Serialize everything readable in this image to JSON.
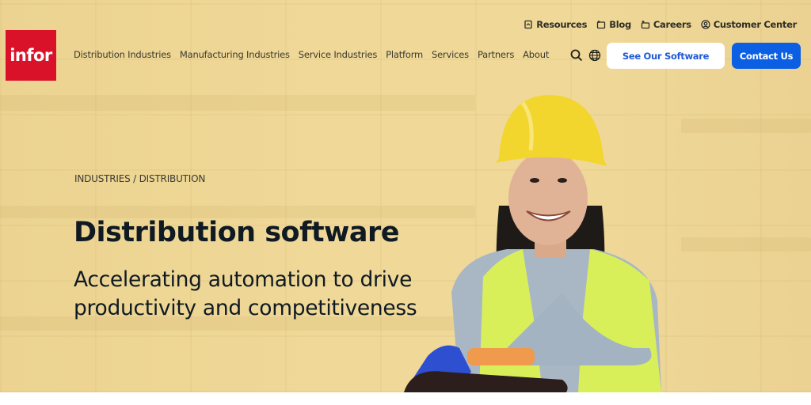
{
  "brand": {
    "logo_text": "infor",
    "logo_color": "#d9122a"
  },
  "nav": {
    "items": [
      {
        "label": "Distribution Industries"
      },
      {
        "label": "Manufacturing Industries"
      },
      {
        "label": "Service Industries"
      },
      {
        "label": "Platform"
      },
      {
        "label": "Services"
      },
      {
        "label": "Partners"
      },
      {
        "label": "About"
      }
    ]
  },
  "utility_links": [
    {
      "label": "Resources",
      "icon": "resources-icon"
    },
    {
      "label": "Blog",
      "icon": "blog-icon"
    },
    {
      "label": "Careers",
      "icon": "careers-icon"
    },
    {
      "label": "Customer Center",
      "icon": "user-circle-icon"
    }
  ],
  "actions": {
    "search_icon": "search-icon",
    "language_icon": "globe-icon",
    "see_software_label": "See Our Software",
    "contact_label": "Contact Us",
    "accent_color": "#0b5fe3"
  },
  "hero": {
    "breadcrumb": "INDUSTRIES / DISTRIBUTION",
    "title": "Distribution software",
    "subtitle": "Accelerating automation to drive productivity and competitiveness",
    "background_color": "#efd898"
  }
}
